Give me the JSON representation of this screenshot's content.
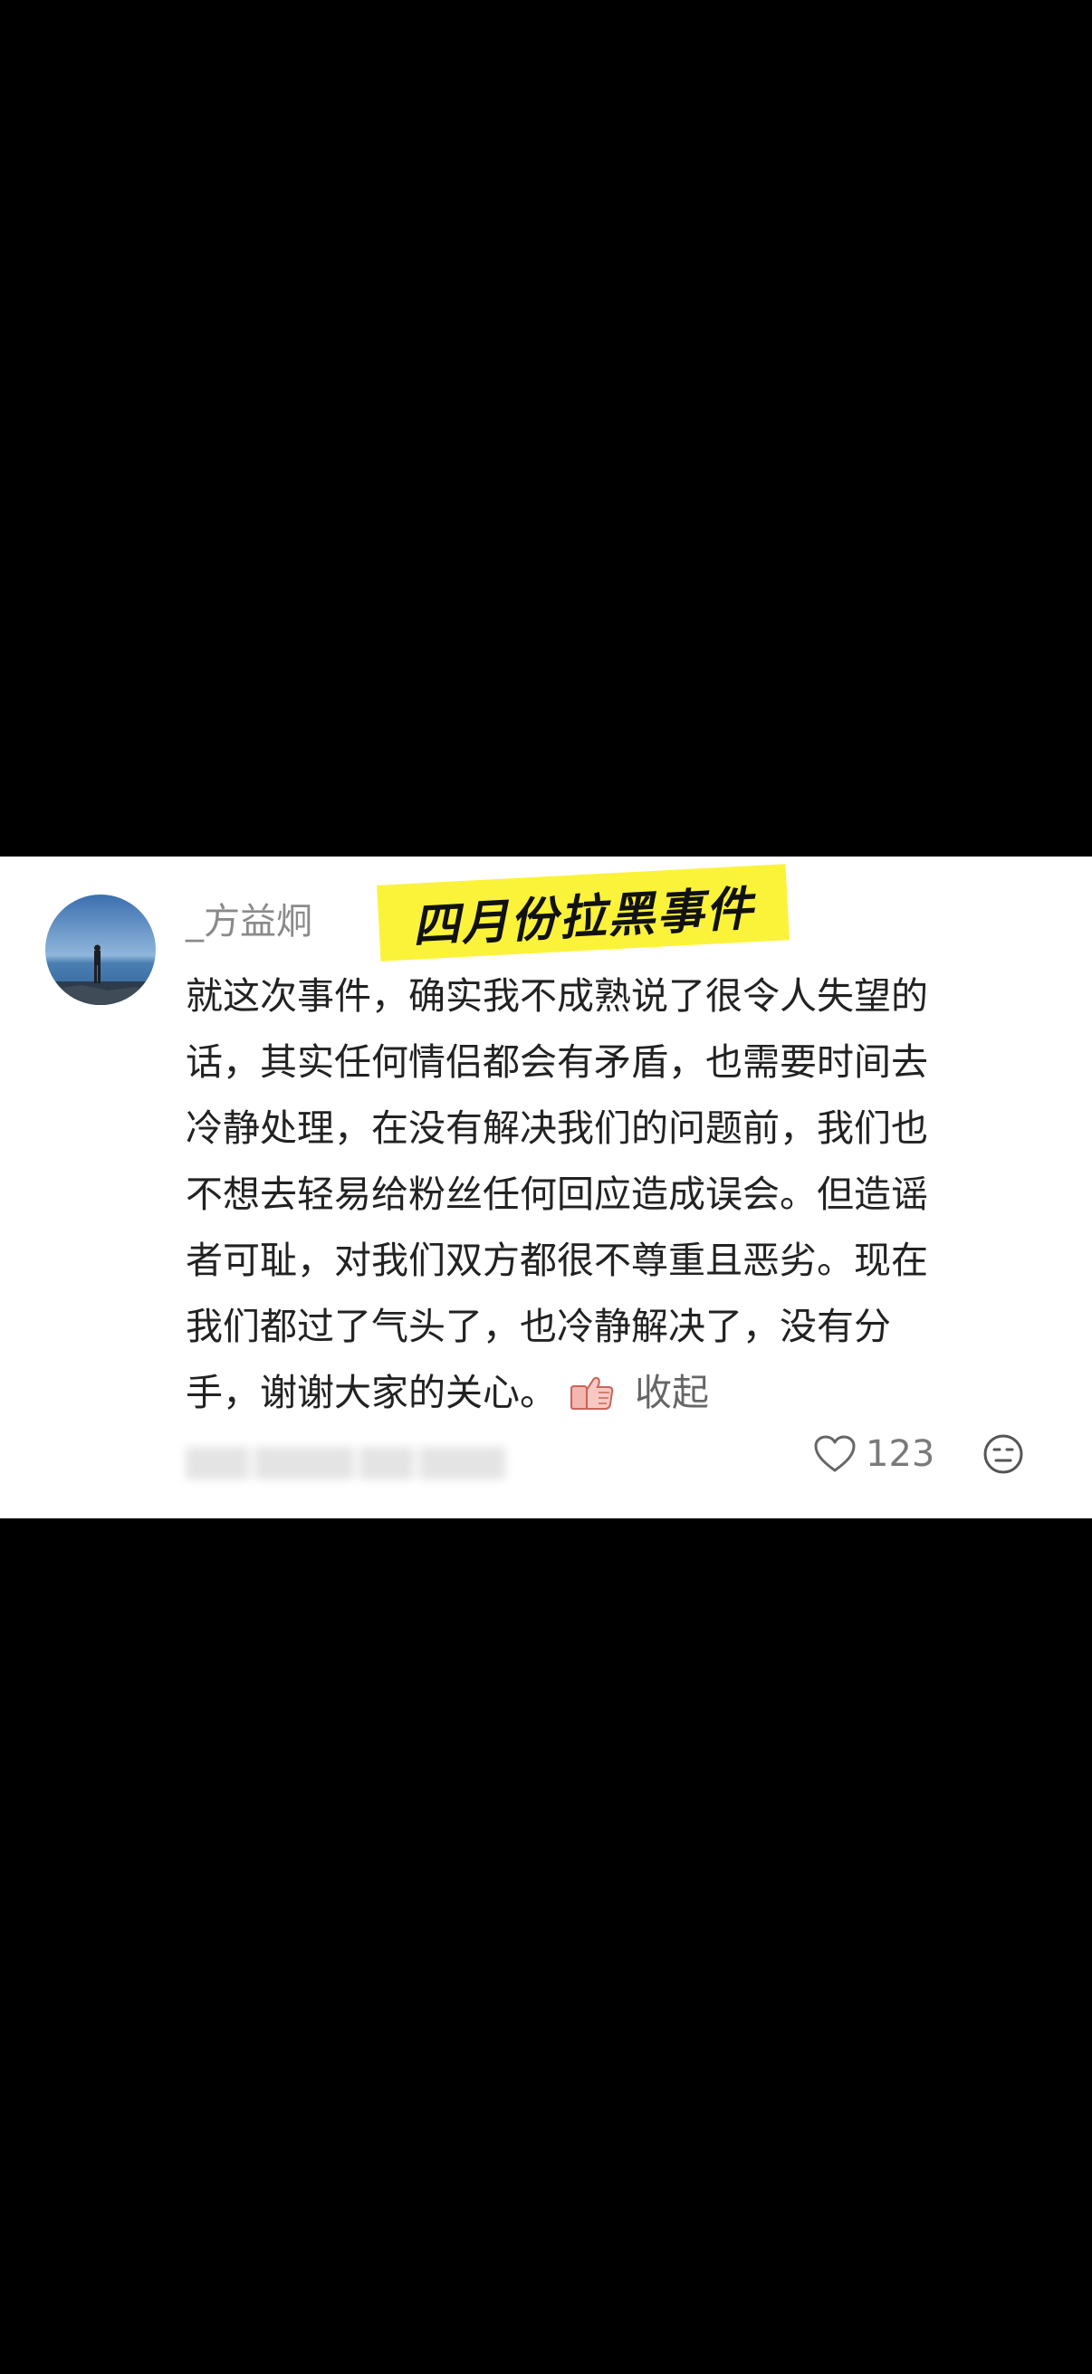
{
  "comment": {
    "username": "_方益炯",
    "tag": "四月份拉黑事件",
    "lines": [
      "就这次事件，确实我不成熟说了很令人失望的",
      "话，其实任何情侣都会有矛盾，也需要时间去",
      "冷静处理，在没有解决我们的问题前，我们也",
      "不想去轻易给粉丝任何回应造成误会。但造谣",
      "者可耻，对我们双方都很不尊重且恶劣。现在",
      "我们都过了气头了，也冷静解决了，没有分",
      "手，谢谢大家的关心。"
    ],
    "inline_emoji": "thumbs-up-emoji",
    "collapse_label": "收起",
    "like_count": "123",
    "like_icon": "heart-outline-icon",
    "reaction_icon": "emoji-face-icon"
  },
  "colors": {
    "background": "#000000",
    "card": "#ffffff",
    "tag_highlight": "#fbf33a",
    "text": "#222222",
    "muted": "#8a8a8a"
  }
}
